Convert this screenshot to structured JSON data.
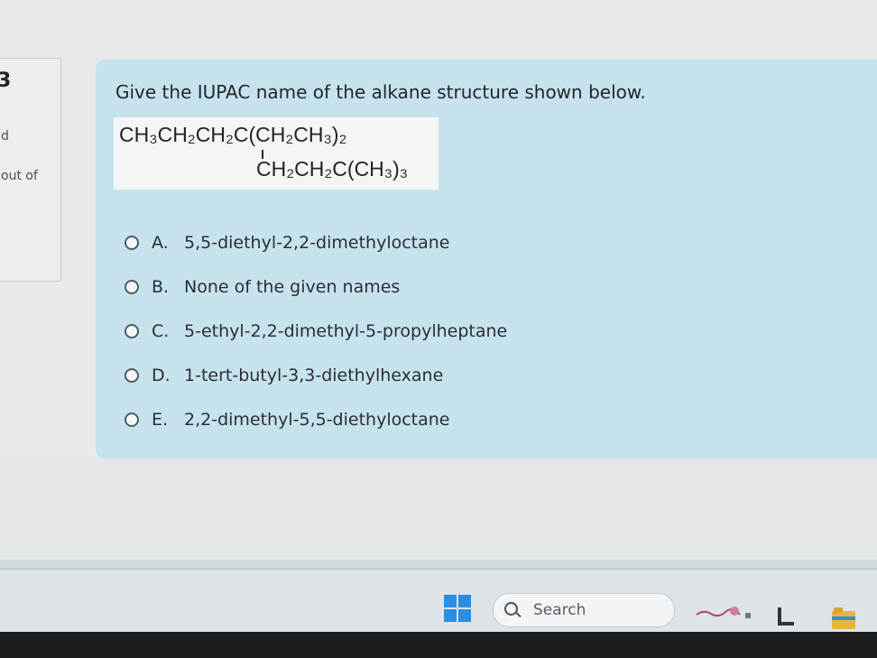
{
  "sidebar": {
    "question_number": "3",
    "status": "d",
    "marks": "out of"
  },
  "question": {
    "prompt": "Give the IUPAC name of the alkane structure shown below.",
    "formula_line1": "CH₃CH₂CH₂C(CH₂CH₃)₂",
    "formula_line2": "CH₂CH₂C(CH₃)₃"
  },
  "options": [
    {
      "letter": "A.",
      "text": "5,5-diethyl-2,2-dimethyloctane"
    },
    {
      "letter": "B.",
      "text": "None of the given names"
    },
    {
      "letter": "C.",
      "text": "5-ethyl-2,2-dimethyl-5-propylheptane"
    },
    {
      "letter": "D.",
      "text": "1-tert-butyl-3,3-diethylhexane"
    },
    {
      "letter": "E.",
      "text": "2,2-dimethyl-5,5-diethyloctane"
    }
  ],
  "taskbar": {
    "search_label": "Search",
    "icons": [
      "windows-start-icon",
      "search-icon",
      "widgets-icon",
      "file-icon",
      "folder-icon"
    ]
  },
  "colors": {
    "question_card": "#c6e2ec",
    "windows_blue": "#2a8fe0"
  }
}
